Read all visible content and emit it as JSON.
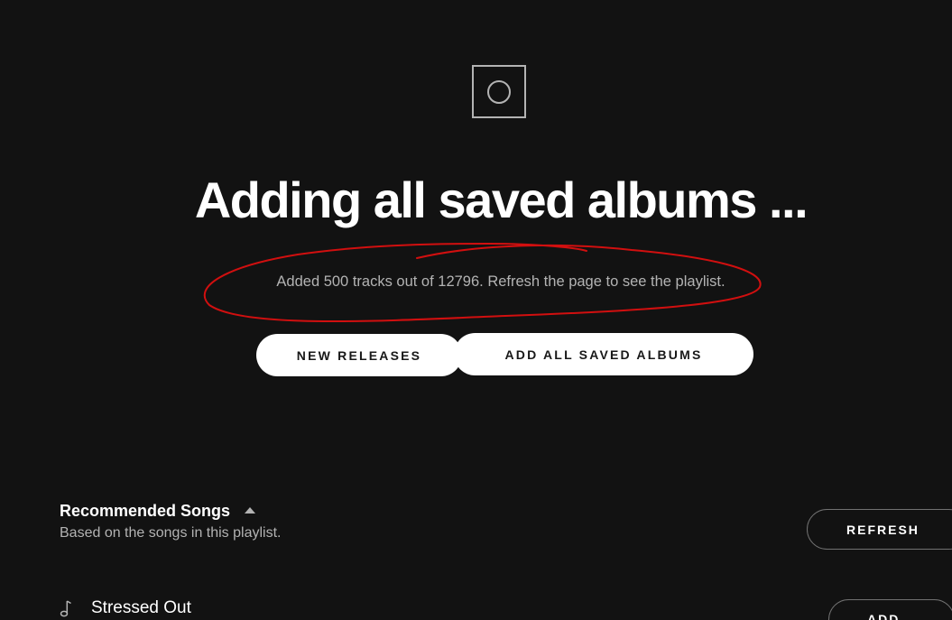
{
  "playlist_cover": {
    "icon": "playlist-cover-circle-icon"
  },
  "header": {
    "title": "Adding all saved albums ..."
  },
  "status": {
    "message": "Added 500 tracks out of 12796. Refresh the page to see the playlist.",
    "annotation_color": "#d10f0f"
  },
  "actions": {
    "new_releases_label": "New Releases",
    "add_all_saved_albums_label": "Add all saved albums"
  },
  "recommended": {
    "title": "Recommended Songs",
    "subtitle": "Based on the songs in this playlist.",
    "refresh_label": "Refresh",
    "tracks": [
      {
        "name": "Stressed Out",
        "add_label": "Add"
      }
    ]
  },
  "colors": {
    "background": "#121212",
    "primary_text": "#ffffff",
    "secondary_text": "#b3b3b3",
    "button_bg": "#ffffff",
    "button_text": "#181818"
  }
}
